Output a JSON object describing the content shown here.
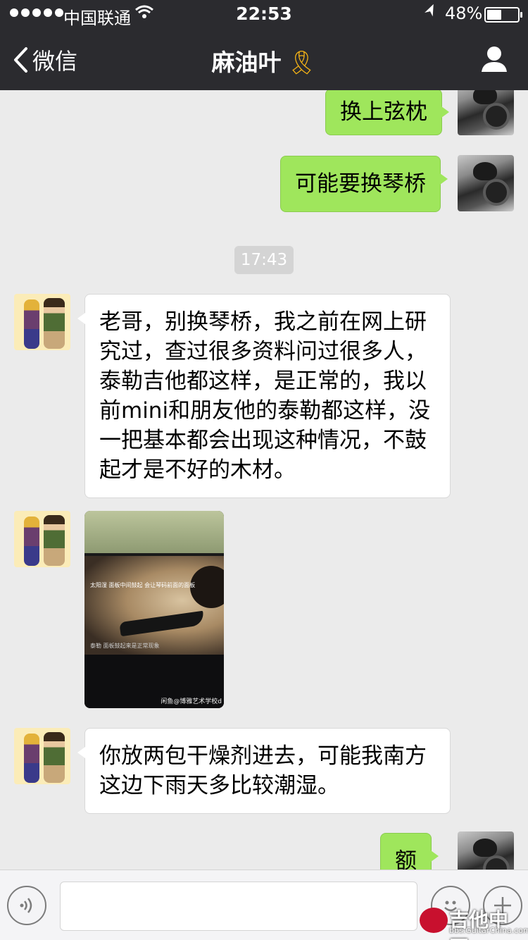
{
  "status_bar": {
    "carrier": "中国联通",
    "time": "22:53",
    "battery_percent_label": "48%",
    "battery_level": 0.48
  },
  "nav": {
    "back_label": "微信",
    "title": "麻油叶",
    "title_emoji": "🎗"
  },
  "messages": [
    {
      "from": "me",
      "text": "换上弦枕"
    },
    {
      "from": "me",
      "text": "可能要换琴桥"
    },
    {
      "type": "time",
      "text": "17:43"
    },
    {
      "from": "friend",
      "text": "老哥，别换琴桥，我之前在网上研究过，查过很多资料问过很多人，泰勒吉他都这样，是正常的，我以前mini和朋友他的泰勒都这样，没一把基本都会出现这种情况，不鼓起才是不好的木材。"
    },
    {
      "from": "friend",
      "type": "image",
      "caption_top": "太阳湿 面板中间鼓起 会让琴码前面的面板",
      "caption_bottom": "泰勒 面板鼓起来是正常现象",
      "watermark": "闲鱼@博雅艺术学校d"
    },
    {
      "from": "friend",
      "text": "你放两包干燥剂进去，可能我南方这边下雨天多比较潮湿。"
    },
    {
      "from": "me",
      "text": "额"
    }
  ],
  "site_watermark": {
    "title": "吉他中国",
    "url": "bbs.GuitarChina.com"
  },
  "colors": {
    "nav_bg": "#2b2b2f",
    "chat_bg": "#ebebeb",
    "outgoing_bubble": "#9fe65c",
    "incoming_bubble": "#ffffff"
  },
  "icons": [
    "back-chevron-icon",
    "person-icon",
    "voice-icon",
    "emoji-icon",
    "plus-icon",
    "wifi-icon",
    "location-arrow-icon",
    "battery-icon"
  ]
}
